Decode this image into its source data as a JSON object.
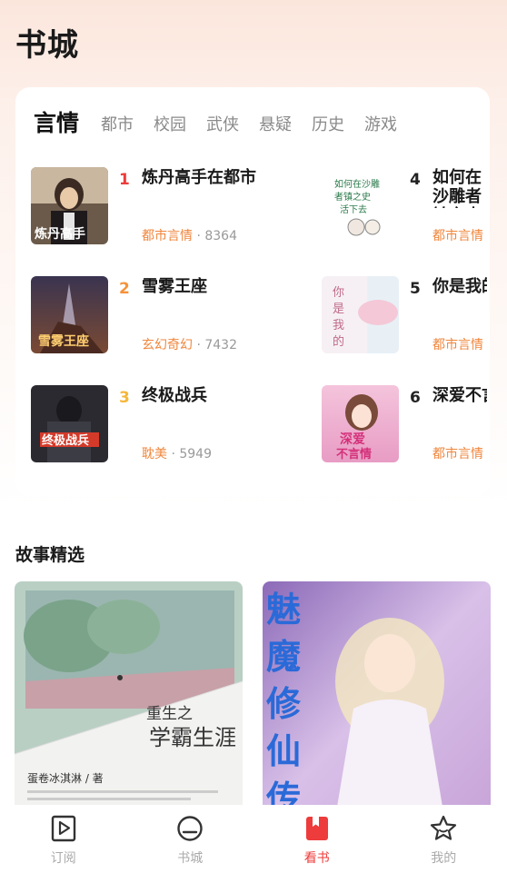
{
  "header": {
    "title": "书城"
  },
  "rank": {
    "tabs": [
      {
        "label": "言情",
        "active": true
      },
      {
        "label": "都市"
      },
      {
        "label": "校园"
      },
      {
        "label": "武侠"
      },
      {
        "label": "悬疑"
      },
      {
        "label": "历史"
      },
      {
        "label": "游戏"
      }
    ],
    "books": [
      {
        "rank": "1",
        "title": "炼丹高手在都市",
        "genre": "都市言情",
        "count": " · 8364"
      },
      {
        "rank": "2",
        "title": "雪雾王座",
        "genre": "玄幻奇幻",
        "count": " · 7432"
      },
      {
        "rank": "3",
        "title": "终极战兵",
        "genre": "耽美",
        "count": " · 5949"
      },
      {
        "rank": "4",
        "title": "如何在沙雕者镇之史活下去",
        "genre": "都市言情",
        "count": ""
      },
      {
        "rank": "5",
        "title": "你是我的",
        "genre": "都市言情",
        "count": ""
      },
      {
        "rank": "6",
        "title": "深爱不言情",
        "genre": "都市言情",
        "count": ""
      }
    ],
    "colors": {
      "rank1": "#ee3b3b",
      "rank2": "#f5923a",
      "rank3": "#f5b73a",
      "other": "#222222"
    }
  },
  "stories": {
    "title": "故事精选",
    "items": [
      {
        "cover_title": "重生之",
        "cover_title2": "学霸生涯",
        "author": "蛋卷冰淇淋 / 著"
      },
      {
        "cover_title": "魅魔修仙传"
      }
    ]
  },
  "nav": {
    "items": [
      {
        "label": "订阅",
        "icon": "play-book-icon",
        "active": false
      },
      {
        "label": "书城",
        "icon": "book-store-icon",
        "active": false
      },
      {
        "label": "看书",
        "icon": "read-book-icon",
        "active": true
      },
      {
        "label": "我的",
        "icon": "star-icon",
        "active": false
      }
    ],
    "active_color": "#ee3b3b",
    "inactive_color": "#aaaaaa"
  }
}
